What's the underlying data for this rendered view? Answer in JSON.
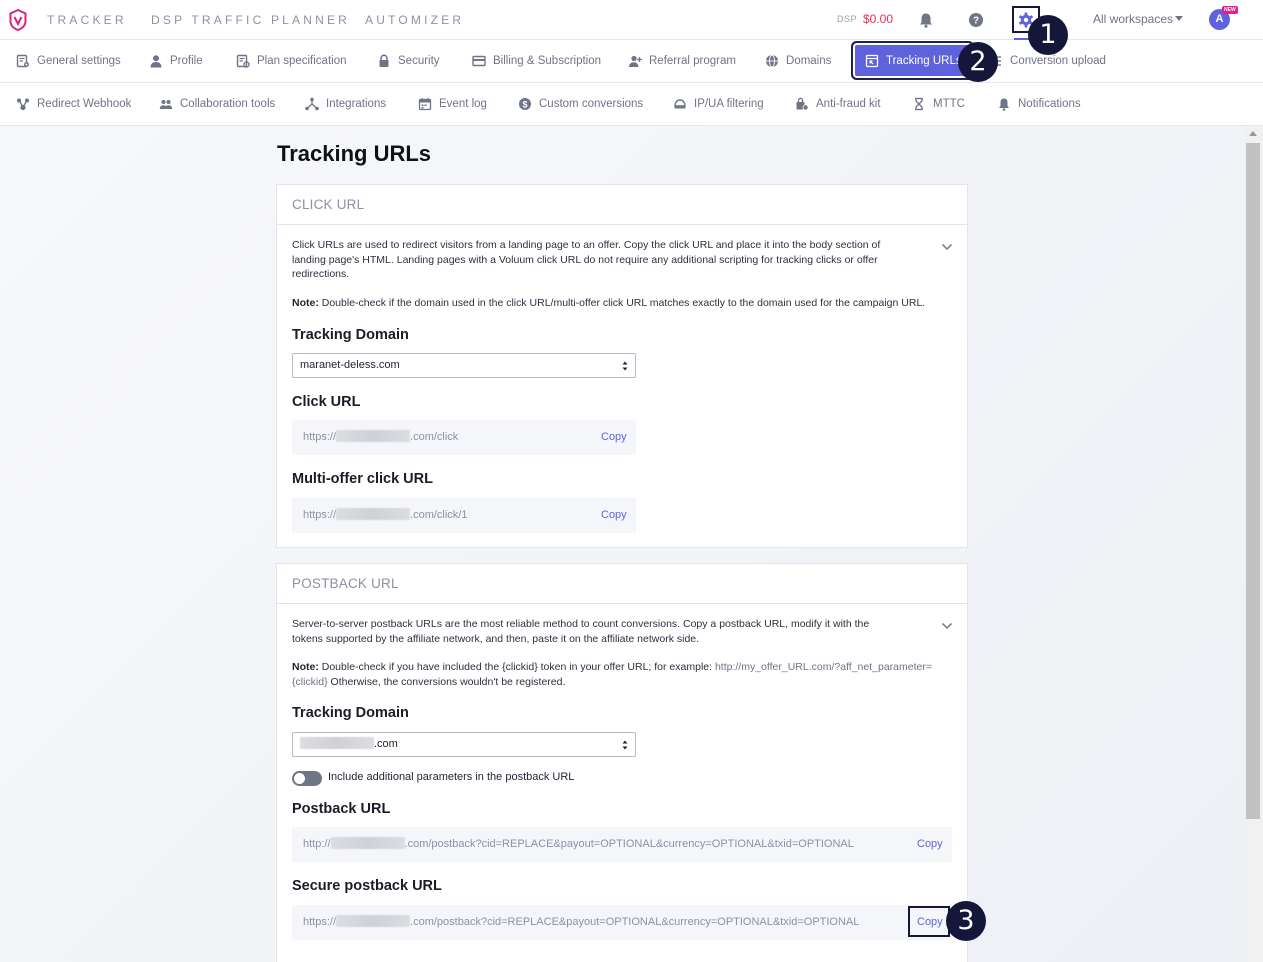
{
  "topbar": {
    "nav": [
      "TRACKER",
      "DSP TRAFFIC PLANNER",
      "AUTOMIZER"
    ],
    "dsp_label": "DSP",
    "dsp_balance": "$0.00",
    "workspaces": "All workspaces",
    "avatar_initial": "A",
    "avatar_badge": "NEW",
    "accent_color": "#5e63dd",
    "balance_color": "#e8314f"
  },
  "tabs_row1": [
    {
      "label": "General settings",
      "icon": "general-settings-icon"
    },
    {
      "label": "Profile",
      "icon": "profile-icon"
    },
    {
      "label": "Plan specification",
      "icon": "plan-icon"
    },
    {
      "label": "Security",
      "icon": "lock-icon"
    },
    {
      "label": "Billing & Subscription",
      "icon": "card-icon"
    },
    {
      "label": "Referral program",
      "icon": "referral-icon"
    },
    {
      "label": "Domains",
      "icon": "globe-icon"
    },
    {
      "label": "Tracking URLs",
      "icon": "tracking-url-icon",
      "active": true
    },
    {
      "label": "Conversion upload",
      "icon": "upload-icon"
    }
  ],
  "tabs_row2": [
    {
      "label": "Redirect Webhook",
      "icon": "webhook-icon"
    },
    {
      "label": "Collaboration tools",
      "icon": "users-icon"
    },
    {
      "label": "Integrations",
      "icon": "integrations-icon"
    },
    {
      "label": "Event log",
      "icon": "calendar-icon"
    },
    {
      "label": "Custom conversions",
      "icon": "dollar-icon"
    },
    {
      "label": "IP/UA filtering",
      "icon": "filter-icon"
    },
    {
      "label": "Anti-fraud kit",
      "icon": "antifraud-icon"
    },
    {
      "label": "MTTC",
      "icon": "hourglass-icon"
    },
    {
      "label": "Notifications",
      "icon": "bell-icon"
    }
  ],
  "page": {
    "title": "Tracking URLs"
  },
  "click": {
    "header": "CLICK URL",
    "desc": "Click URLs are used to redirect visitors from a landing page to an offer. Copy the click URL and place it into the body section of landing page's HTML. Landing pages with a Voluum click URL do not require any additional scripting for tracking clicks or offer redirections.",
    "note_label": "Note:",
    "note_text": " Double-check if the domain used in the click URL/multi-offer click URL matches exactly to the domain used for the campaign URL.",
    "domain_label": "Tracking Domain",
    "domain_value": "maranet-deless.com",
    "click_url_label": "Click URL",
    "click_url_prefix": "https://",
    "click_url_suffix": ".com/click",
    "multi_label": "Multi-offer click URL",
    "multi_prefix": "https://",
    "multi_suffix": ".com/click/1",
    "copy": "Copy"
  },
  "postback": {
    "header": "POSTBACK URL",
    "desc": "Server-to-server postback URLs are the most reliable method to count conversions. Copy a postback URL, modify it with the tokens supported by the affiliate network, and then, paste it on the affiliate network side.",
    "note_label": "Note:",
    "note_text": " Double-check if you have included the {clickid} token in your offer URL; for example:  ",
    "note_example": "http://my_offer_URL.com/?aff_net_parameter={clickid}",
    "note_tail": "  Otherwise, the conversions wouldn't be registered.",
    "domain_label": "Tracking Domain",
    "domain_suffix": ".com",
    "toggle_label": "Include additional parameters in the postback URL",
    "postback_label": "Postback URL",
    "postback_prefix": "http://",
    "postback_suffix": ".com/postback?cid=REPLACE&payout=OPTIONAL&currency=OPTIONAL&txid=OPTIONAL",
    "secure_label": "Secure postback URL",
    "secure_prefix": "https://",
    "secure_suffix": ".com/postback?cid=REPLACE&payout=OPTIONAL&currency=OPTIONAL&txid=OPTIONAL",
    "copy": "Copy"
  },
  "callouts": [
    "1",
    "2",
    "3"
  ]
}
